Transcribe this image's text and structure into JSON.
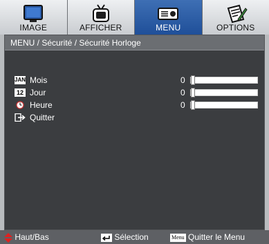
{
  "tabs": [
    {
      "label": "IMAGE",
      "icon": "monitor-icon",
      "active": false
    },
    {
      "label": "AFFICHER",
      "icon": "tv-icon",
      "active": false
    },
    {
      "label": "MENU",
      "icon": "projector-icon",
      "active": true
    },
    {
      "label": "OPTIONS",
      "icon": "notepad-pencil-icon",
      "active": false
    }
  ],
  "breadcrumb": "MENU / Sécurité / Sécurité Horloge",
  "items": [
    {
      "icon_text": "JAN",
      "label": "Mois",
      "value": "0",
      "level": 0
    },
    {
      "icon_text": "12",
      "label": "Jour",
      "value": "0",
      "level": 0
    },
    {
      "icon_text": "",
      "label": "Heure",
      "value": "0",
      "level": 0
    },
    {
      "icon_text": "",
      "label": "Quitter"
    }
  ],
  "footer": {
    "nav": "Haut/Bas",
    "select": "Sélection",
    "menu_key": "Menu",
    "exit": "Quitter le Menu"
  },
  "colors": {
    "accent": "#2a5aa6",
    "nav_arrow": "#e02020",
    "panel": "#3b3d40"
  }
}
